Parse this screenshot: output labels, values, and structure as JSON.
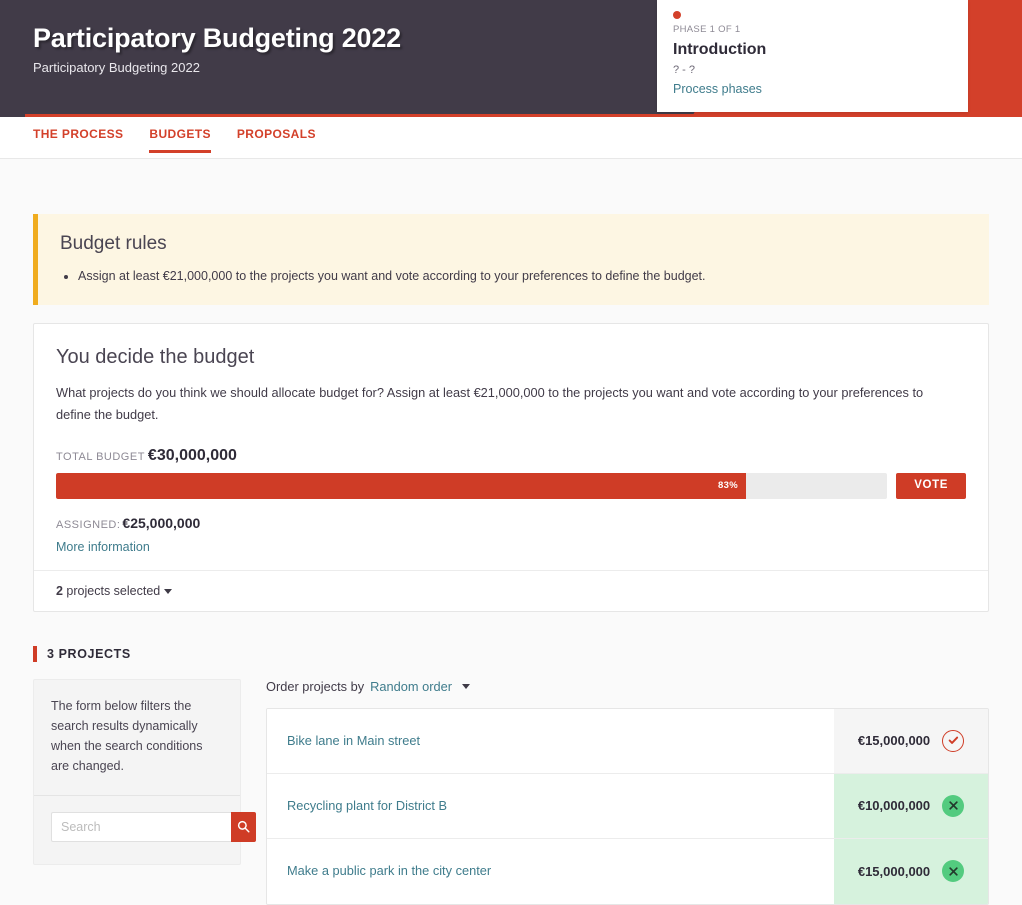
{
  "hero": {
    "title": "Participatory Budgeting 2022",
    "subtitle": "Participatory Budgeting 2022",
    "accent_color": "#d3402a",
    "background_color": "#413b48"
  },
  "phase_card": {
    "phase_count": "PHASE 1 OF 1",
    "phase_name": "Introduction",
    "dates": "? - ?",
    "link": "Process phases",
    "dot_color": "#d3402a"
  },
  "tabs": [
    {
      "label": "THE PROCESS",
      "active": false
    },
    {
      "label": "BUDGETS",
      "active": true
    },
    {
      "label": "PROPOSALS",
      "active": false
    }
  ],
  "budget_rules": {
    "title": "Budget rules",
    "rules": [
      "Assign at least €21,000,000 to the projects you want and vote according to your preferences to define the budget."
    ],
    "border_color": "#f0ac1e",
    "background_color": "#fdf6e3"
  },
  "budget_card": {
    "title": "You decide the budget",
    "description": "What projects do you think we should allocate budget for? Assign at least €21,000,000 to the projects you want and vote according to your preferences to define the budget.",
    "total_budget_label": "TOTAL BUDGET",
    "total_budget_value": "€30,000,000",
    "progress_percent": "83%",
    "progress_fill_ratio": 83,
    "vote_button": "VOTE",
    "assigned_label": "ASSIGNED:",
    "assigned_value": "€25,000,000",
    "more_information": "More information",
    "selected_summary_count": "2",
    "selected_summary_text": " projects selected"
  },
  "projects_section": {
    "heading": "3 PROJECTS",
    "filters_help": "The form below filters the search results dynamically when the search conditions are changed.",
    "search_placeholder": "Search",
    "search_value": "",
    "search_icon": "search-icon",
    "order_label": "Order projects by",
    "order_value": "Random order",
    "projects": [
      {
        "title": "Bike lane in Main street",
        "amount": "€15,000,000",
        "state": "unselected",
        "action_icon": "check-icon"
      },
      {
        "title": "Recycling plant for District B",
        "amount": "€10,000,000",
        "state": "selected",
        "action_icon": "close-icon"
      },
      {
        "title": "Make a public park in the city center",
        "amount": "€15,000,000",
        "state": "selected",
        "action_icon": "close-icon"
      }
    ]
  }
}
